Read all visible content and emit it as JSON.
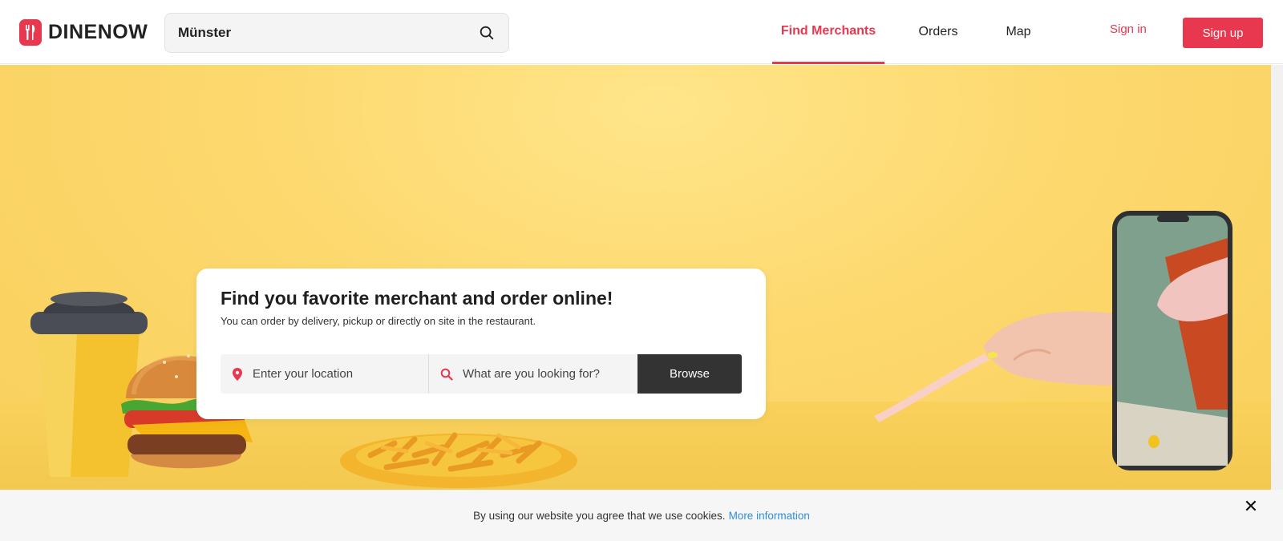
{
  "brand": {
    "name": "DINENOW",
    "color": "#e8384f"
  },
  "top_search": {
    "value": "Münster",
    "icon": "search-icon"
  },
  "nav": {
    "items": [
      {
        "label": "Find Merchants",
        "active": true
      },
      {
        "label": "Orders",
        "active": false
      },
      {
        "label": "Map",
        "active": false
      }
    ],
    "signin": "Sign in",
    "signup": "Sign up"
  },
  "hero": {
    "title": "Find you favorite merchant and order online!",
    "subtitle": "You can order by delivery, pickup or directly on site in the restaurant.",
    "location_placeholder": "Enter your location",
    "query_placeholder": "What are you looking for?",
    "browse_label": "Browse",
    "background_color": "#fdd86d"
  },
  "cookie": {
    "text": "By using our website you agree that we use cookies.",
    "link": "More information",
    "close": "✕"
  }
}
